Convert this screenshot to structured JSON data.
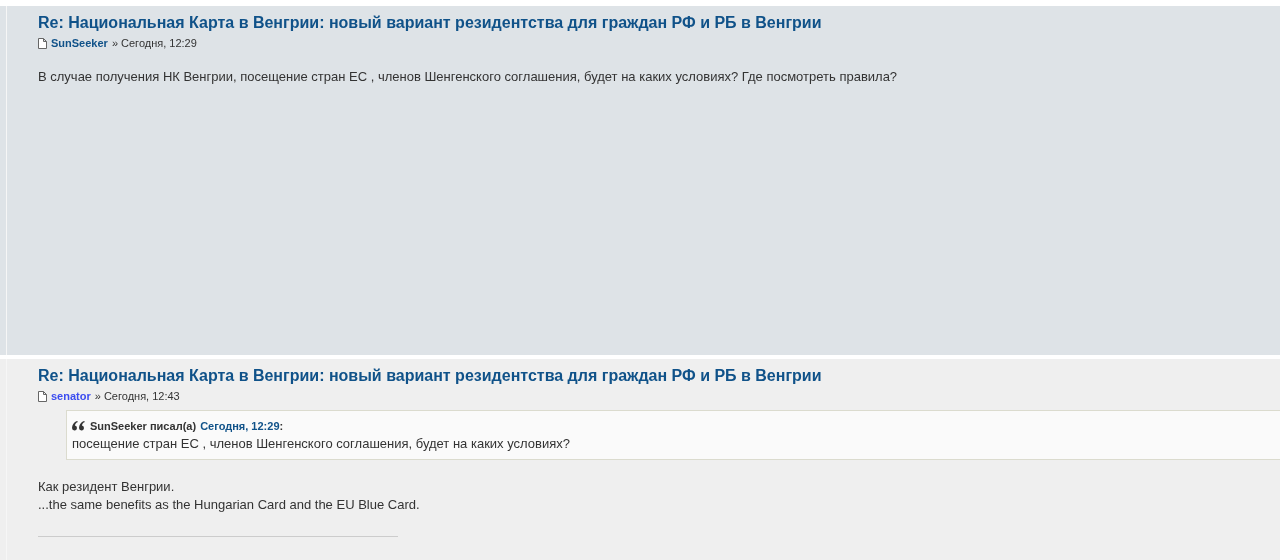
{
  "posts": [
    {
      "title": "Re: Национальная Карта в Венгрии: новый вариант резидентства для граждан РФ и РБ в Венгрии",
      "author": {
        "name": "SunSeeker",
        "color": "#105289"
      },
      "time": "» Сегодня, 12:29",
      "color": "#dee3e7",
      "paragraphs": [
        "В случае получения НК Венгрии, посещение стран ЕС , членов Шенгенского соглашения, будет на каких условиях? Где посмотреть правила?"
      ]
    },
    {
      "title": "Re: Национальная Карта в Венгрии: новый вариант резидентства для граждан РФ и РБ в Венгрии",
      "author": {
        "name": "senator",
        "color": "#3b4cf0"
      },
      "time": "» Сегодня, 12:43",
      "color": "#efefef",
      "quote": {
        "author": "SunSeeker писал(а)",
        "time": "Сегодня, 12:29",
        "colon": ":",
        "text": "посещение стран ЕС , членов Шенгенского соглашения, будет на каких условиях?"
      },
      "paragraphs": [
        "Как резидент Венгрии.",
        "...the same benefits as the Hungarian Card and the EU Blue Card."
      ]
    }
  ]
}
